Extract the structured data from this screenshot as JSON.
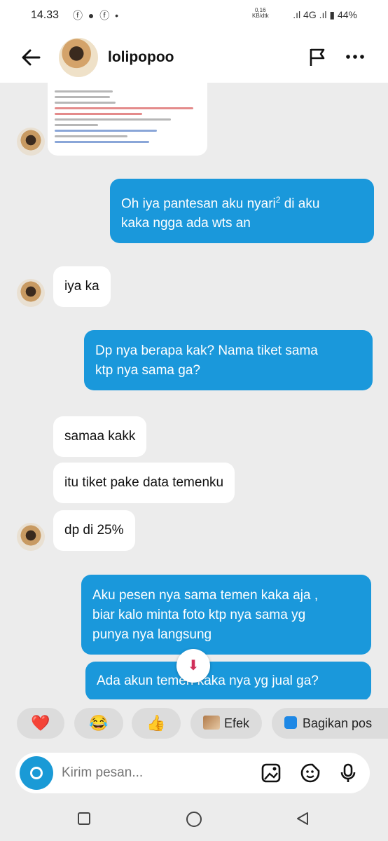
{
  "status": {
    "time": "14.33",
    "icons": "ⓕ ● ⓕ •",
    "speed_value": "0,16",
    "speed_unit": "KB/dtk",
    "right": ".ıl 4G .ıl ▮ 44%"
  },
  "header": {
    "username": "lolipopoo"
  },
  "messages": {
    "out1_line1": "Oh iya pantesan aku nyari",
    "out1_sup": "2",
    "out1_line1b": " di aku",
    "out1_line2": "kaka ngga ada wts an",
    "in1": "iya ka",
    "out2_line1": "Dp nya berapa kak? Nama tiket sama",
    "out2_line2": "ktp nya sama ga?",
    "in2": "samaa kakk",
    "in3": "itu tiket pake data temenku",
    "in4": "dp di 25%",
    "out3_line1": "Aku pesen nya sama temen kaka aja ,",
    "out3_line2": "biar kalo minta foto ktp nya sama yg",
    "out3_line3": "punya nya langsung",
    "out4": "Ada akun temen kaka nya yg jual ga?"
  },
  "reactions": {
    "heart": "❤️",
    "laugh": "😂",
    "thumbs": "👍",
    "effect_label": "Efek",
    "share_label": "Bagikan pos"
  },
  "composer": {
    "placeholder": "Kirim pesan..."
  }
}
